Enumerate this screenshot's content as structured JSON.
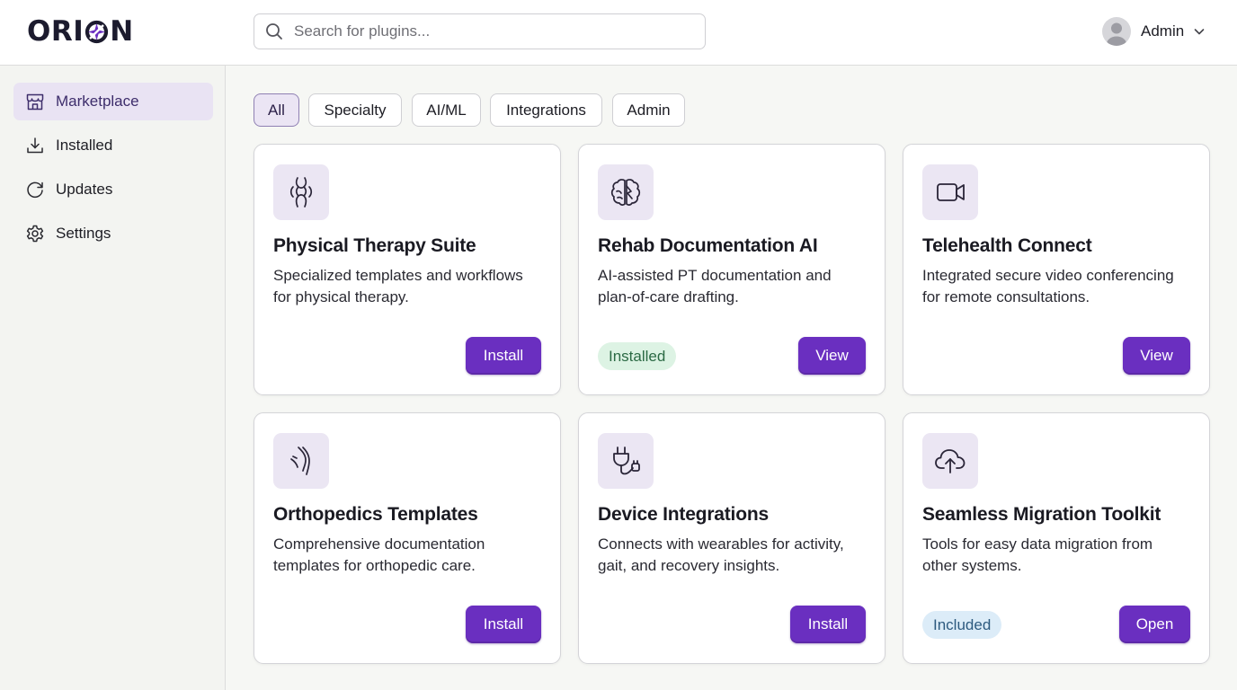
{
  "app": {
    "logo_left": "ORI",
    "logo_right": "N",
    "logo_accent": "#6a2fc0"
  },
  "search": {
    "placeholder": "Search for plugins...",
    "icon": "search-icon"
  },
  "user": {
    "name": "Admin",
    "icon": "chevron-down-icon"
  },
  "sidebar": {
    "items": [
      {
        "label": "Marketplace",
        "icon": "storefront-icon",
        "active": true
      },
      {
        "label": "Installed",
        "icon": "download-icon",
        "active": false
      },
      {
        "label": "Updates",
        "icon": "refresh-icon",
        "active": false
      },
      {
        "label": "Settings",
        "icon": "gear-icon",
        "active": false
      }
    ]
  },
  "filters": [
    {
      "label": "All",
      "active": true
    },
    {
      "label": "Specialty",
      "active": false
    },
    {
      "label": "AI/ML",
      "active": false
    },
    {
      "label": "Integrations",
      "active": false
    },
    {
      "label": "Admin",
      "active": false
    }
  ],
  "cards": [
    {
      "title": "Physical Therapy Suite",
      "desc_line1": "Specialized templates and workflows",
      "desc_line2": "for physical therapy.",
      "icon": "joint-icon",
      "badge": "",
      "button": "Install"
    },
    {
      "title": "Rehab Documentation AI",
      "desc_line1": "AI-assisted PT documentation and",
      "desc_line2": "plan-of-care drafting.",
      "icon": "brain-icon",
      "badge": "Installed",
      "button": "View"
    },
    {
      "title": "Telehealth Connect",
      "desc_line1": "Integrated secure video conferencing",
      "desc_line2": "for remote consultations.",
      "icon": "video-camera-icon",
      "badge": "",
      "button": "View"
    },
    {
      "title": "Orthopedics Templates",
      "desc_line1": "Comprehensive documentation",
      "desc_line2": "templates for orthopedic care.",
      "icon": "bone-icon",
      "badge": "",
      "button": "Install"
    },
    {
      "title": "Device Integrations",
      "desc_line1": "Connects with wearables for activity,",
      "desc_line2": "gait, and recovery insights.",
      "icon": "plug-icon",
      "badge": "",
      "button": "Install"
    },
    {
      "title": "Seamless Migration Toolkit",
      "desc_line1": "Tools for easy data migration from",
      "desc_line2": "other systems.",
      "icon": "cloud-upload-icon",
      "badge": "Included",
      "button": "Open"
    }
  ],
  "colors": {
    "primary_button": "#6a2fc0",
    "active_nav_bg": "#e9e3f3",
    "icon_tile_bg": "#ebe6f3",
    "installed_badge_bg": "#ddf3e4",
    "included_badge_bg": "#dcecf8"
  }
}
